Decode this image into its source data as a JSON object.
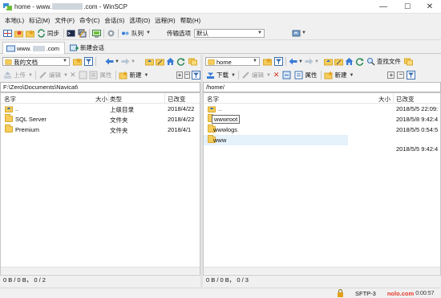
{
  "window": {
    "title_prefix": "home - www.",
    "title_suffix": ".com - WinSCP",
    "minimize": "—",
    "maximize": "☐",
    "close": "✕"
  },
  "menu": [
    "本地(L)",
    "标记(M)",
    "文件(F)",
    "命令(C)",
    "会话(S)",
    "选项(O)",
    "远程(R)",
    "帮助(H)"
  ],
  "toolbar": {
    "sync_label": "同步",
    "queue_label": "队列",
    "transfer_label": "传输选项",
    "transfer_value": "默认"
  },
  "tabs": {
    "session_prefix": "www.",
    "session_suffix": ".com",
    "new_session": "新建会话"
  },
  "left": {
    "location": "我的文档",
    "upload": "上传",
    "edit": "编辑",
    "properties": "属性",
    "new": "新建",
    "path": "F:\\Zero\\Documents\\Navicat\\",
    "columns": {
      "name": "名字",
      "size": "大小",
      "type": "类型",
      "changed": "已改变"
    },
    "rows": [
      {
        "name": "..",
        "size": "",
        "type": "上级目录",
        "changed": "2018/4/22"
      },
      {
        "name": "SQL Server",
        "size": "",
        "type": "文件夹",
        "changed": "2018/4/22"
      },
      {
        "name": "Premium",
        "size": "",
        "type": "文件夹",
        "changed": "2018/4/1"
      }
    ],
    "status": "0 B / 0 B， 0 / 2"
  },
  "right": {
    "location": "home",
    "find_files": "查找文件",
    "download": "下载",
    "edit": "编辑",
    "properties": "属性",
    "new": "新建",
    "path": "/home/",
    "columns": {
      "name": "名字",
      "size": "大小",
      "changed": "已改变"
    },
    "rows": [
      {
        "name": "..",
        "changed": "2018/5/5 22:09:"
      },
      {
        "name": "wwwroot",
        "changed": "2018/5/8 9:42:4"
      },
      {
        "name": "wwwlogs",
        "changed": "2018/5/5 0:54:5"
      },
      {
        "name": "www",
        "changed": "2018/5/5 9:42:4"
      }
    ],
    "status": "0 B / 0 B， 0 / 3"
  },
  "statusbar": {
    "protocol": "SFTP-3",
    "watermark": "nolo.com",
    "time": "0:00:57"
  }
}
